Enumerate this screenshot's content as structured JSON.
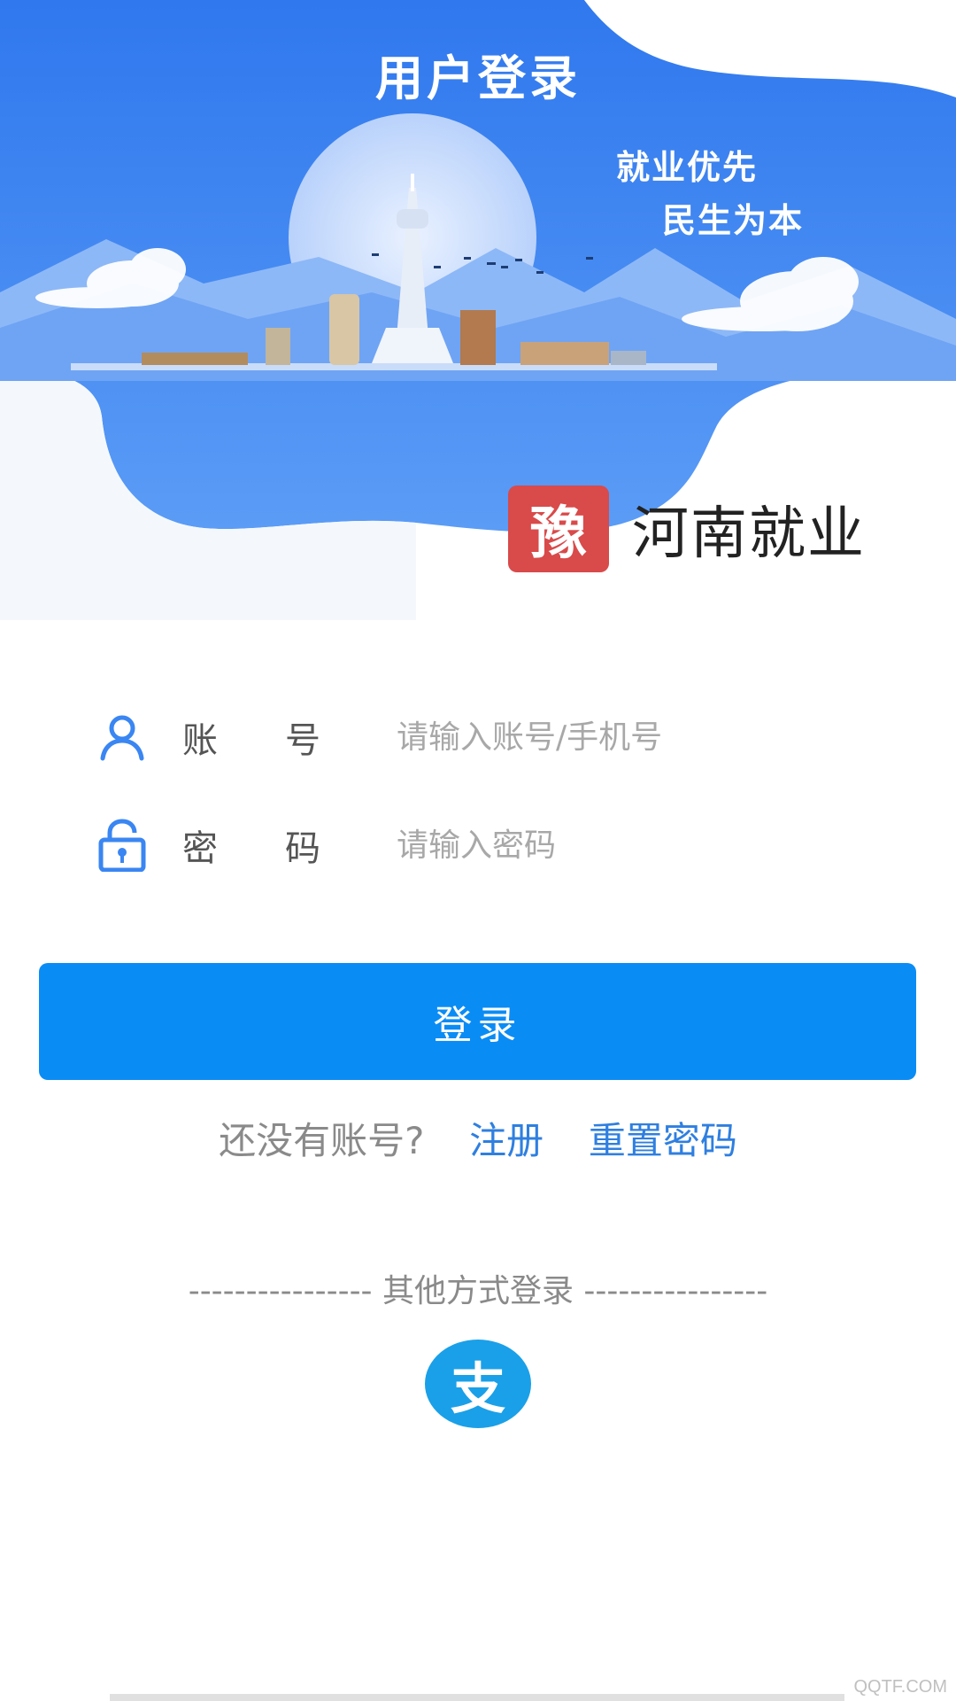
{
  "header": {
    "title": "用户登录",
    "slogan_line1": "就业优先",
    "slogan_line2": "民生为本"
  },
  "brand": {
    "logo_char": "豫",
    "name": "河南就业"
  },
  "form": {
    "account_label": "账号",
    "account_placeholder": "请输入账号/手机号",
    "account_icon": "user-icon",
    "password_label": "密码",
    "password_placeholder": "请输入密码",
    "password_icon": "lock-icon"
  },
  "login_button": "登录",
  "links": {
    "prompt": "还没有账号?",
    "register": "注册",
    "reset_password": "重置密码"
  },
  "other_login": {
    "label": "---------------- 其他方式登录 ----------------",
    "alipay_char": "支",
    "alipay_icon": "alipay-icon"
  },
  "watermark": "QQTF.COM",
  "colors": {
    "hero_blue": "#3a86f2",
    "button_blue": "#0a8cf5",
    "link_blue": "#2f7fe0",
    "brand_red": "#d94a4a",
    "alipay_blue": "#1aa0e8"
  }
}
